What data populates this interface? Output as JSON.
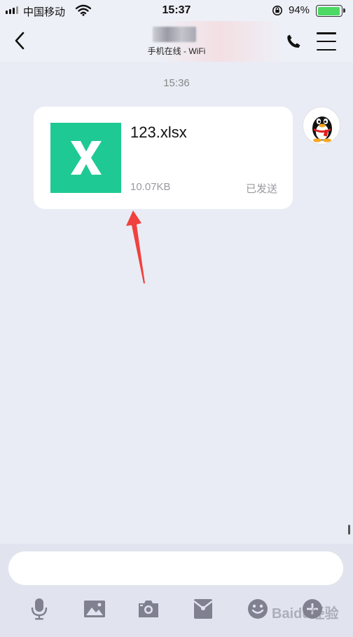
{
  "status_bar": {
    "carrier": "中国移动",
    "time": "15:37",
    "battery_percent": "94%",
    "battery_level": 0.94
  },
  "nav": {
    "contact_status": "手机在线 - WiFi"
  },
  "chat": {
    "timestamp": "15:36",
    "file_message": {
      "file_name": "123.xlsx",
      "file_size": "10.07KB",
      "status": "已发送",
      "icon_letter": "X"
    }
  },
  "input": {
    "placeholder": ""
  },
  "watermark": "Baidu经验",
  "colors": {
    "excel_green": "#1fc994",
    "background": "#e9ecf5",
    "arrow_red": "#f0413f",
    "toolbar_icon": "#808091"
  },
  "icons": [
    "signal-icon",
    "wifi-icon",
    "orientation-lock-icon",
    "battery-icon",
    "back-icon",
    "phone-icon",
    "menu-icon",
    "mic-icon",
    "image-icon",
    "camera-icon",
    "red-envelope-icon",
    "emoji-icon",
    "plus-icon"
  ]
}
